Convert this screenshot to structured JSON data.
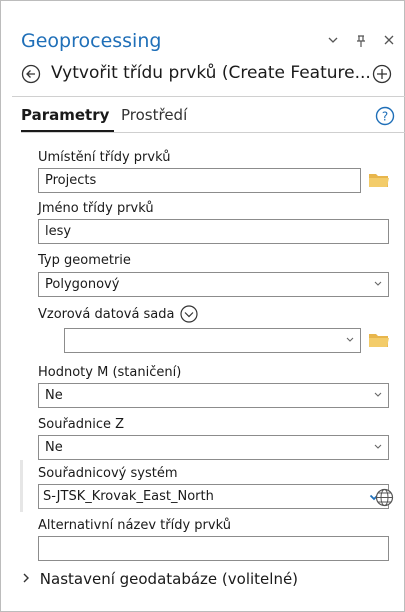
{
  "pane": {
    "title": "Geoprocessing"
  },
  "header_icons": [
    "dropdown-icon",
    "pin-icon",
    "close-icon"
  ],
  "tool": {
    "title": "Vytvořit třídu prvků (Create Feature..."
  },
  "tabs": [
    {
      "label": "Parametry",
      "active": true
    },
    {
      "label": "Prostředí",
      "active": false
    }
  ],
  "params": {
    "location": {
      "label": "Umístění třídy prvků",
      "value": "Projects"
    },
    "name": {
      "label": "Jméno třídy prvků",
      "value": "lesy"
    },
    "geometry": {
      "label": "Typ geometrie",
      "value": "Polygonový"
    },
    "template": {
      "label": "Vzorová datová sada",
      "value": ""
    },
    "m_values": {
      "label": "Hodnoty M (staničení)",
      "value": "Ne"
    },
    "z_values": {
      "label": "Souřadnice Z",
      "value": "Ne"
    },
    "crs": {
      "label": "Souřadnicový systém",
      "value": "S-JTSK_Krovak_East_North"
    },
    "alias": {
      "label": "Alternativní název třídy prvků",
      "value": ""
    }
  },
  "expander": {
    "label": "Nastavení geodatabáze (volitelné)"
  },
  "colors": {
    "accent": "#1f6fb8",
    "folder": "#e8b64c"
  }
}
